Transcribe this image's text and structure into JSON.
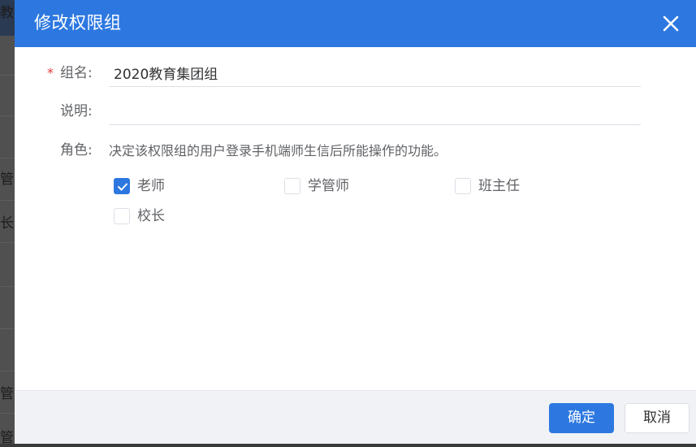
{
  "background": {
    "fragments": [
      "教",
      "管",
      "长",
      "管",
      "管"
    ]
  },
  "dialog": {
    "title": "修改权限组",
    "form": {
      "name_label": "组名:",
      "name_value": "2020教育集团组",
      "desc_label": "说明:",
      "desc_value": "",
      "role_label": "角色:",
      "role_help": "决定该权限组的用户登录手机端师生信后所能操作的功能。",
      "roles": [
        {
          "label": "老师",
          "checked": true
        },
        {
          "label": "学管师",
          "checked": false
        },
        {
          "label": "班主任",
          "checked": false
        },
        {
          "label": "校长",
          "checked": false
        }
      ]
    },
    "buttons": {
      "confirm": "确定",
      "cancel": "取消"
    }
  },
  "colors": {
    "primary": "#2d78e0",
    "required": "#e4393c"
  }
}
